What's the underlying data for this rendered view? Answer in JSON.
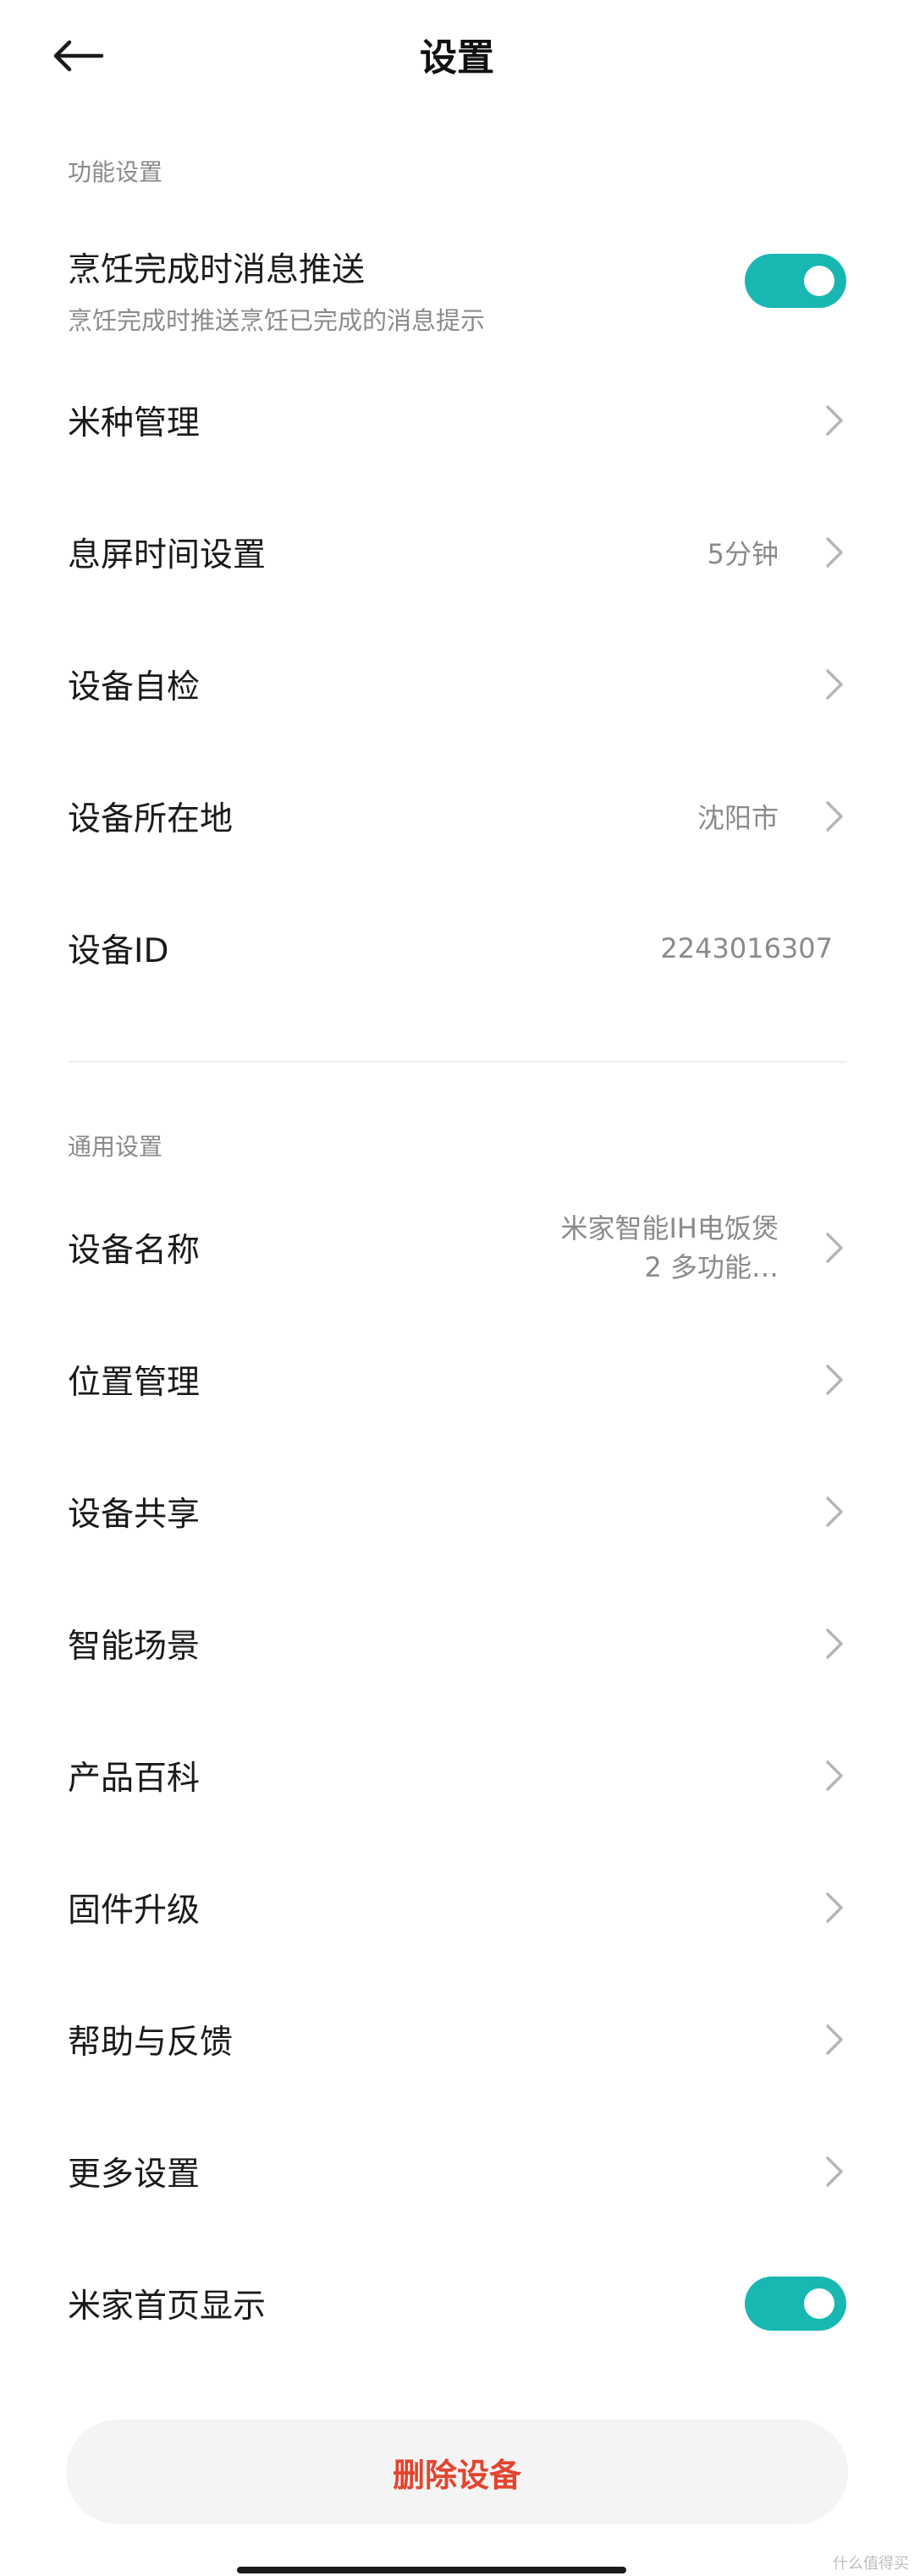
{
  "header": {
    "title": "设置"
  },
  "sections": {
    "function_label": "功能设置",
    "general_label": "通用设置"
  },
  "cook_push": {
    "label": "烹饪完成时消息推送",
    "subtitle": "烹饪完成时推送烹饪已完成的消息提示",
    "enabled": true
  },
  "items": {
    "rice_type": {
      "label": "米种管理"
    },
    "screen_off": {
      "label": "息屏时间设置",
      "value": "5分钟"
    },
    "self_check": {
      "label": "设备自检"
    },
    "location": {
      "label": "设备所在地",
      "value": "沈阳市"
    },
    "device_id": {
      "label": "设备ID",
      "value": "2243016307"
    },
    "device_name": {
      "label": "设备名称",
      "value": "米家智能IH电饭煲2 多功能…"
    },
    "position_mgmt": {
      "label": "位置管理"
    },
    "share": {
      "label": "设备共享"
    },
    "scenes": {
      "label": "智能场景"
    },
    "wiki": {
      "label": "产品百科"
    },
    "firmware": {
      "label": "固件升级"
    },
    "help": {
      "label": "帮助与反馈"
    },
    "more": {
      "label": "更多设置"
    },
    "home_display": {
      "label": "米家首页显示",
      "enabled": true
    }
  },
  "actions": {
    "delete_label": "删除设备"
  },
  "watermark": "什么值得买",
  "colors": {
    "accent": "#19b7b2",
    "danger": "#e2452f",
    "secondary_text": "#8a8a8a"
  },
  "icons": {
    "back": "back-arrow-icon",
    "chevron": "chevron-right-icon"
  }
}
